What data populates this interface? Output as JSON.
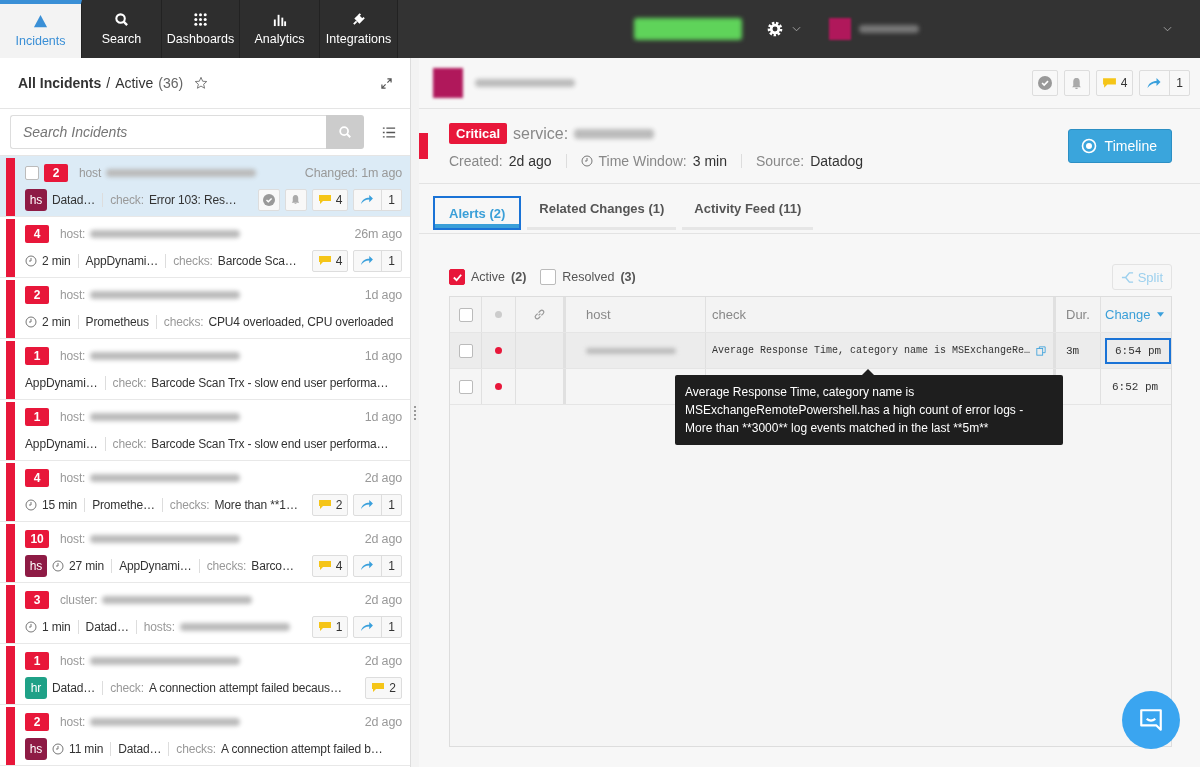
{
  "nav": {
    "tabs": [
      {
        "label": "Incidents",
        "kind": "warning",
        "selected": true
      },
      {
        "label": "Search",
        "kind": "search",
        "selected": false
      },
      {
        "label": "Dashboards",
        "kind": "grid",
        "selected": false
      },
      {
        "label": "Analytics",
        "kind": "bars",
        "selected": false
      },
      {
        "label": "Integrations",
        "kind": "plug",
        "selected": false
      }
    ]
  },
  "list": {
    "title": "All Incidents",
    "separator": "/",
    "filter": "Active",
    "count": "(36)",
    "search": {
      "placeholder": "Search Incidents"
    },
    "incidents": [
      {
        "selected": true,
        "count": "2",
        "label": "host",
        "time": "Changed: 1m ago",
        "avatar": {
          "initials": "hs",
          "color": "#8e1b45"
        },
        "source": "Datad…",
        "check_label": "check:",
        "check": "Error 103: Res…",
        "comments": "4",
        "shares": "1"
      },
      {
        "selected": false,
        "count": "4",
        "label": "host:",
        "time": "26m ago",
        "duration": "2 min",
        "source": "AppDynami…",
        "check_label": "checks:",
        "check": "Barcode Sca…",
        "comments": "4",
        "shares": "1"
      },
      {
        "selected": false,
        "count": "2",
        "label": "host:",
        "time": "1d ago",
        "duration": "2 min",
        "source": "Prometheus",
        "check_label": "checks:",
        "check": "CPU4 overloaded, CPU overloaded"
      },
      {
        "selected": false,
        "count": "1",
        "label": "host:",
        "time": "1d ago",
        "source": "AppDynami…",
        "check_label": "check:",
        "check": "Barcode Scan Trx - slow end user performa…"
      },
      {
        "selected": false,
        "count": "1",
        "label": "host:",
        "time": "1d ago",
        "source": "AppDynami…",
        "check_label": "check:",
        "check": "Barcode Scan Trx - slow end user performa…"
      },
      {
        "selected": false,
        "count": "4",
        "label": "host:",
        "time": "2d ago",
        "duration": "15 min",
        "source": "Promethe…",
        "check_label": "checks:",
        "check": "More than **1…",
        "comments": "2",
        "shares": "1"
      },
      {
        "selected": false,
        "count": "10",
        "label": "host:",
        "time": "2d ago",
        "avatar": {
          "initials": "hs",
          "color": "#8e1b45"
        },
        "duration": "27 min",
        "source": "AppDynami…",
        "check_label": "checks:",
        "check": "Barco…",
        "comments": "4",
        "shares": "1"
      },
      {
        "selected": false,
        "count": "3",
        "label": "cluster:",
        "time": "2d ago",
        "duration": "1 min",
        "source": "Datad…",
        "check_label": "hosts:",
        "comments": "1",
        "shares": "1"
      },
      {
        "selected": false,
        "count": "1",
        "label": "host:",
        "time": "2d ago",
        "avatar": {
          "initials": "hr",
          "color": "#1fa187"
        },
        "source": "Datad…",
        "check_label": "check:",
        "check": "A connection attempt failed becaus…",
        "comments": "2"
      },
      {
        "selected": false,
        "count": "2",
        "label": "host:",
        "time": "2d ago",
        "avatar": {
          "initials": "hs",
          "color": "#8e1b45"
        },
        "duration": "11 min",
        "source": "Datad…",
        "check_label": "checks:",
        "check": "A connection attempt failed b…"
      }
    ]
  },
  "detail": {
    "comments": "4",
    "shares": "1",
    "severity": "Critical",
    "service_label": "service:",
    "created_label": "Created:",
    "created": "2d ago",
    "window_label": "Time Window:",
    "window": "3 min",
    "source_label": "Source:",
    "source": "Datadog",
    "timeline_button": "Timeline",
    "tabs": [
      {
        "label": "Alerts (2)",
        "selected": true
      },
      {
        "label": "Related Changes (1)",
        "selected": false
      },
      {
        "label": "Activity Feed (11)",
        "selected": false
      }
    ],
    "filters": [
      {
        "label": "Active",
        "count": "(2)",
        "checked": true
      },
      {
        "label": "Resolved",
        "count": "(3)",
        "checked": false
      }
    ],
    "split_button": "Split",
    "table": {
      "select_all_checked": false,
      "columns": [
        "host",
        "check",
        "Dur.",
        "Change"
      ],
      "rows": [
        {
          "checked": false,
          "check": "Average Response Time, category name is MSExchangeRe…",
          "duration": "3m",
          "change": "6:54 pm",
          "selected": true
        },
        {
          "checked": false,
          "change": "6:52 pm",
          "selected": false
        }
      ]
    },
    "tooltip": "Average Response Time, category name is MSExchangeRemotePowershell.has a high count of error logs - More than **3000** log events matched in the last **5m**"
  }
}
